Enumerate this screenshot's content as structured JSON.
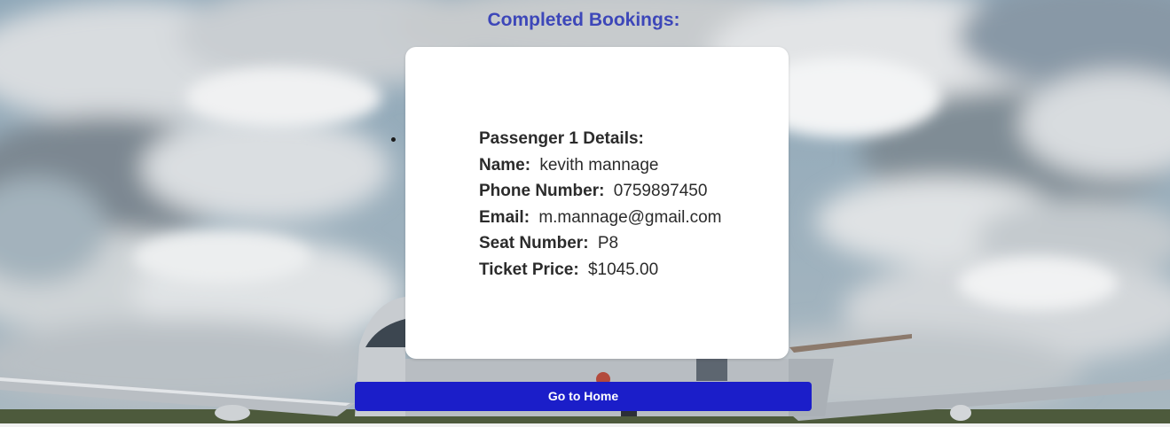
{
  "page": {
    "heading": "Completed Bookings:"
  },
  "booking": {
    "title": "Passenger 1 Details:",
    "fields": [
      {
        "label": "Name:",
        "value": "kevith mannage"
      },
      {
        "label": "Phone Number:",
        "value": "0759897450"
      },
      {
        "label": "Email:",
        "value": "m.mannage@gmail.com"
      },
      {
        "label": "Seat Number:",
        "value": "P8"
      },
      {
        "label": "Ticket Price:",
        "value": "$1045.00"
      }
    ]
  },
  "actions": {
    "home_label": "Go to Home"
  },
  "colors": {
    "heading": "#3d47b9",
    "button_bg": "#1b1ec9",
    "card_bg": "#ffffff"
  },
  "icons": {
    "background": "airplane-clouds-background"
  }
}
